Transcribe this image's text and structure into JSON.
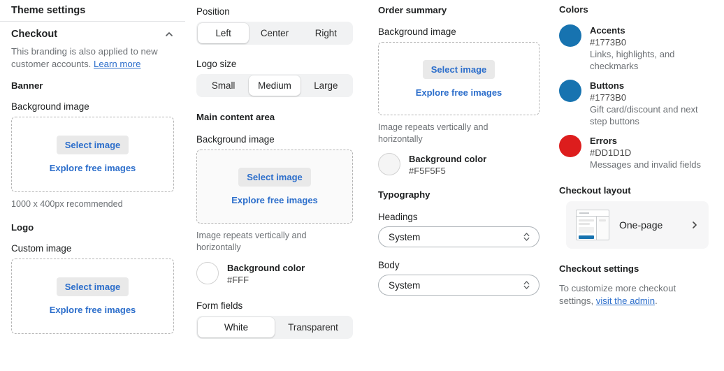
{
  "panel": {
    "title": "Theme settings"
  },
  "checkout_section": {
    "heading": "Checkout",
    "collapse_icon": "chevron-up-icon",
    "helper_text": "This branding is also applied to new customer accounts.",
    "helper_link": "Learn more"
  },
  "banner": {
    "heading": "Banner",
    "background_image_label": "Background image",
    "select_image_label": "Select image",
    "explore_label": "Explore free images",
    "recommendation": "1000 x 400px recommended"
  },
  "logo": {
    "heading": "Logo",
    "custom_image_label": "Custom image",
    "select_image_label": "Select image",
    "explore_label": "Explore free images",
    "position_label": "Position",
    "position_options": [
      "Left",
      "Center",
      "Right"
    ],
    "position_selected": "Left",
    "size_label": "Logo size",
    "size_options": [
      "Small",
      "Medium",
      "Large"
    ],
    "size_selected": "Medium"
  },
  "main_content": {
    "heading": "Main content area",
    "background_image_label": "Background image",
    "select_image_label": "Select image",
    "explore_label": "Explore free images",
    "repeat_caption": "Image repeats vertically and horizontally",
    "background_color_label": "Background color",
    "background_color_value": "#FFF",
    "background_color_swatch": "#FFFFFF",
    "form_fields_label": "Form fields",
    "form_fields_options": [
      "White",
      "Transparent"
    ],
    "form_fields_selected": "White"
  },
  "order_summary": {
    "heading": "Order summary",
    "background_image_label": "Background image",
    "select_image_label": "Select image",
    "explore_label": "Explore free images",
    "repeat_caption": "Image repeats vertically and horizontally",
    "background_color_label": "Background color",
    "background_color_value": "#F5F5F5",
    "background_color_swatch": "#F5F5F5"
  },
  "typography": {
    "heading": "Typography",
    "headings_label": "Headings",
    "headings_value": "System",
    "body_label": "Body",
    "body_value": "System",
    "select_icon": "chevron-updown-icon"
  },
  "colors": {
    "heading": "Colors",
    "items": [
      {
        "name": "Accents",
        "hex": "#1773B0",
        "swatch": "#1773B0",
        "description": "Links, highlights, and checkmarks"
      },
      {
        "name": "Buttons",
        "hex": "#1773B0",
        "swatch": "#1773B0",
        "description": "Gift card/discount and next step buttons"
      },
      {
        "name": "Errors",
        "hex": "#DD1D1D",
        "swatch": "#DD1D1D",
        "description": "Messages and invalid fields"
      }
    ]
  },
  "checkout_layout": {
    "heading": "Checkout layout",
    "selected": "One-page",
    "thumb_icon": "one-page-layout-icon",
    "chevron_icon": "chevron-right-icon"
  },
  "checkout_settings": {
    "heading": "Checkout settings",
    "text_before": "To customize more checkout settings, ",
    "link": "visit the admin",
    "text_after": "."
  }
}
